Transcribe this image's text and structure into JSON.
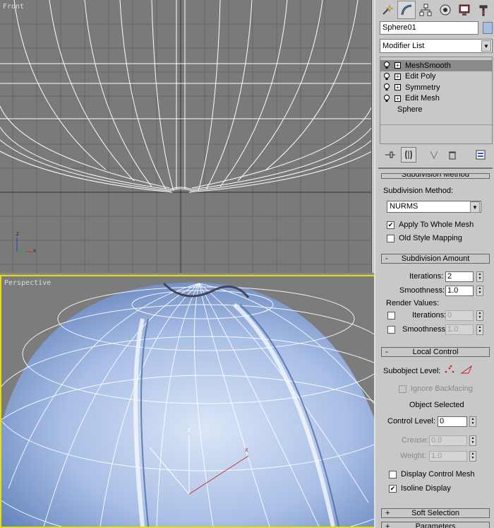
{
  "viewports": {
    "front_label": "Front",
    "perspective_label": "Perspective",
    "axis_x": "x",
    "axis_z": "z"
  },
  "panel": {
    "tabs": [
      "create-icon",
      "modify-icon",
      "hierarchy-icon",
      "motion-icon",
      "display-icon",
      "utilities-icon"
    ],
    "object_name": "Sphere01",
    "object_color": "#a7bfe7",
    "modifier_list_label": "Modifier List",
    "stack": [
      {
        "label": "MeshSmooth",
        "selected": true
      },
      {
        "label": "Edit Poly"
      },
      {
        "label": "Symmetry"
      },
      {
        "label": "Edit Mesh"
      }
    ],
    "stack_base": "Sphere"
  },
  "subdivision_method": {
    "rollout_title": "Subdivision Method",
    "method_label": "Subdivision Method:",
    "method_value": "NURMS",
    "apply_whole_mesh": "Apply To Whole Mesh",
    "old_style": "Old Style Mapping"
  },
  "subdivision_amount": {
    "rollout_title": "Subdivision Amount",
    "sign": "-",
    "iterations_label": "Iterations:",
    "iterations_value": "2",
    "smoothness_label": "Smoothness:",
    "smoothness_value": "1.0",
    "render_values_label": "Render Values:",
    "render_iterations_label": "Iterations:",
    "render_iterations_value": "0",
    "render_smoothness_label": "Smoothness:",
    "render_smoothness_value": "1.0"
  },
  "local_control": {
    "rollout_title": "Local Control",
    "sign": "-",
    "subobject_label": "Subobject Level:",
    "ignore_backfacing": "Ignore Backfacing",
    "object_selected": "Object Selected",
    "control_level_label": "Control Level:",
    "control_level_value": "0",
    "crease_label": "Crease:",
    "crease_value": "0.0",
    "weight_label": "Weight:",
    "weight_value": "1.0",
    "display_control_mesh": "Display Control Mesh",
    "isoline_display": "Isoline Display"
  },
  "soft_selection": {
    "rollout_title": "Soft Selection",
    "sign": "+"
  },
  "parameters": {
    "rollout_title": "Parameters",
    "sign": "+"
  }
}
